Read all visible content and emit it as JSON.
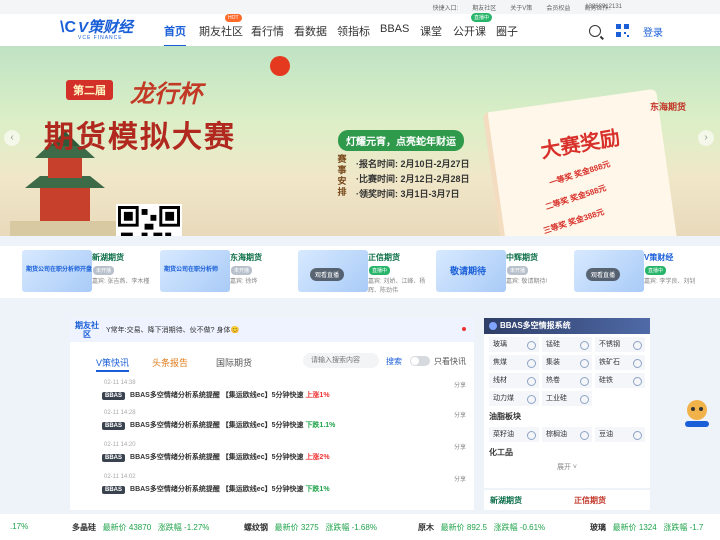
{
  "topbar": {
    "quick": "快捷入口:",
    "forum": "期友社区",
    "about": "关于V策",
    "member": "会员权益",
    "biz": "商务合作:",
    "phone": "13262912131"
  },
  "nav": {
    "logo_cn": "V策财经",
    "logo_en": "VCE FINANCE",
    "items": [
      "首页",
      "期友社区",
      "看行情",
      "看数据",
      "领指标",
      "BBAS",
      "课堂",
      "公开课",
      "圈子"
    ],
    "hot": "HOT",
    "live": "直播中",
    "login": "登录"
  },
  "banner": {
    "edition": "第二届",
    "cup": "龙行杯",
    "title": "期货模拟大赛",
    "slogan": "灯耀元宵，点亮蛇年财运",
    "sched_head": "赛事安排",
    "schedule": [
      "·报名时间: 2月10日-2月27日",
      "·比赛时间: 2月12日-2月28日",
      "·领奖时间: 3月1日-3月7日"
    ],
    "prize": "大赛奖励",
    "prize_lines": [
      "一等奖 奖金888元",
      "二等奖 奖金588元",
      "三等奖 奖金388元"
    ],
    "brand": "东海期货"
  },
  "ads": [
    {
      "title": "新湖期货",
      "thumb": "期货公司在职分析师开盘",
      "status": "未开播",
      "guests": "嘉宾: 张吉燕、李木槿"
    },
    {
      "title": "东海期货",
      "thumb": "期货公司在职分析师",
      "status": "未开播",
      "guests": "嘉宾: 徐烨"
    },
    {
      "title": "正信期货",
      "thumb": "",
      "status": "直播中",
      "guests": "嘉宾: 刘娇、江峰、杨辉、陈劲伟",
      "play": "观看直播"
    },
    {
      "title": "中辉期货",
      "thumb": "敬请期待",
      "status": "未开播",
      "guests": "嘉宾: 敬请期待!"
    },
    {
      "title": "V策财经",
      "thumb": "",
      "status": "直播中",
      "guests": "嘉宾: 李学良、刘钊",
      "play": "观看直播"
    }
  ],
  "feed": {
    "friends_label": "期友社区",
    "friends_msg": "Y常年:交易、降下消期待、伙不做? 身体😊",
    "tabs": [
      "V策快讯",
      "头条报告",
      "国际期货"
    ],
    "search_placeholder": "请输入搜索内容",
    "search_btn": "搜索",
    "toggle_label": "只看快讯",
    "share": "分享",
    "items": [
      {
        "time": "02-11 14:38",
        "text": "BBAS多空情绪分析系统提醒 【集运欧线ec】5分钟快速",
        "move": "上涨1%",
        "dir": "up"
      },
      {
        "time": "02-11 14:28",
        "text": "BBAS多空情绪分析系统提醒 【集运欧线ec】5分钟快速",
        "move": "下跌1.1%",
        "dir": "down"
      },
      {
        "time": "02-11 14:20",
        "text": "BBAS多空情绪分析系统提醒 【集运欧线ec】5分钟快速",
        "move": "上涨2%",
        "dir": "up"
      },
      {
        "time": "02-11 14:02",
        "text": "BBAS多空情绪分析系统提醒 【集运欧线ec】5分钟快速",
        "move": "下跌1%",
        "dir": "down"
      }
    ]
  },
  "side": {
    "title": "BBAS多空情报系统",
    "grid1": [
      "玻璃",
      "锰硅",
      "不锈钢",
      "焦煤",
      "集装",
      "铁矿石",
      "线材",
      "热卷",
      "硅铁",
      "动力煤",
      "工业硅"
    ],
    "sec1": "油脂板块",
    "grid2": [
      "菜籽油",
      "棕榈油",
      "豆油"
    ],
    "sec2": "化工品",
    "expand": "展开 ˅",
    "ad1": "新湖期货",
    "ad2": "正信期货"
  },
  "ticker": [
    {
      "name": "",
      "price": "",
      "change": ".17%"
    },
    {
      "name": "多晶硅",
      "price": "最新价 43870",
      "change": "涨跌幅 -1.27%"
    },
    {
      "name": "螺纹钢",
      "price": "最新价 3275",
      "change": "涨跌幅 -1.68%"
    },
    {
      "name": "原木",
      "price": "最新价 892.5",
      "change": "涨跌幅 -0.61%"
    },
    {
      "name": "玻璃",
      "price": "最新价 1324",
      "change": "涨跌幅 -1.7"
    }
  ]
}
